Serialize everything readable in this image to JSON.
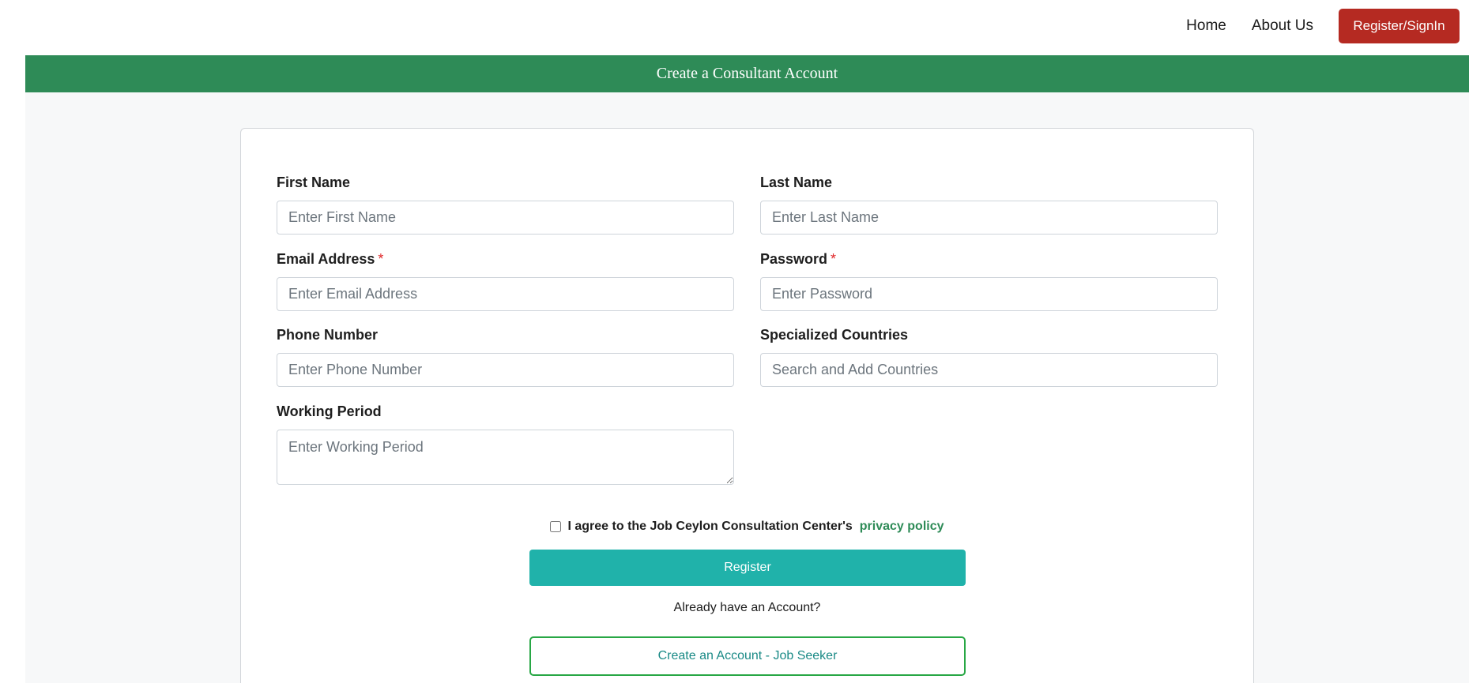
{
  "nav": {
    "home": "Home",
    "about": "About Us",
    "cta": "Register/SignIn"
  },
  "header": {
    "title": "Create a Consultant Account"
  },
  "form": {
    "first_name": {
      "label": "First Name",
      "placeholder": "Enter First Name",
      "value": ""
    },
    "last_name": {
      "label": "Last Name",
      "placeholder": "Enter Last Name",
      "value": ""
    },
    "email": {
      "label": "Email Address",
      "required_mark": "*",
      "placeholder": "Enter Email Address",
      "value": ""
    },
    "password": {
      "label": "Password",
      "required_mark": "*",
      "placeholder": "Enter Password",
      "value": ""
    },
    "phone": {
      "label": "Phone Number",
      "placeholder": "Enter Phone Number",
      "value": ""
    },
    "countries": {
      "label": "Specialized Countries",
      "placeholder": "Search and Add Countries",
      "value": ""
    },
    "working_period": {
      "label": "Working Period",
      "placeholder": "Enter Working Period",
      "value": ""
    },
    "agree": {
      "checked": false,
      "text": "I agree to the Job Ceylon Consultation Center's",
      "link": "privacy policy"
    },
    "register_button": "Register",
    "already_text": "Already have an Account?",
    "jobseeker_button": "Create an Account - Job Seeker"
  },
  "colors": {
    "header_green": "#2e8b57",
    "cta_red": "#b52a22",
    "register_teal": "#20b2aa",
    "required_red": "#e0282a"
  }
}
